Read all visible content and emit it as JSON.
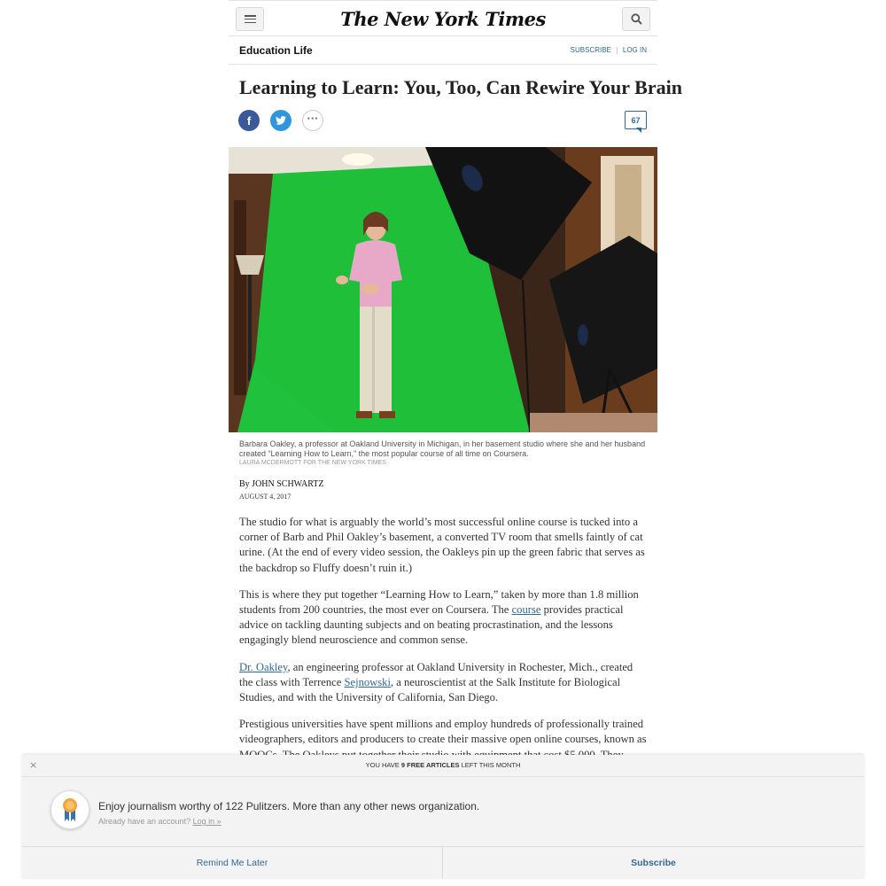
{
  "header": {
    "masthead": "The New York Times",
    "menu_icon": "hamburger-menu-icon",
    "search_icon": "search-icon"
  },
  "section": {
    "name": "Education Life",
    "subscribe": "SUBSCRIBE",
    "login": "LOG IN"
  },
  "article": {
    "headline": "Learning to Learn: You, Too, Can Rewire Your Brain",
    "share": {
      "facebook": "f",
      "more": "···"
    },
    "comment_count": "67",
    "caption": "Barbara Oakley, a professor at Oakland University in Michigan, in her basement studio where she and her husband created “Learning How to Learn,” the most popular course of all time on Coursera.",
    "credit": "LAURA MCDERMOTT FOR THE NEW YORK TIMES",
    "byline_prefix": "By",
    "author": "JOHN SCHWARTZ",
    "date": "AUGUST 4, 2017",
    "p1": "The studio for what is arguably the world’s most successful online course is tucked into a corner of Barb and Phil Oakley’s basement, a converted TV room that smells faintly of cat urine. (At the end of every video session, the Oakleys pin up the green fabric that serves as the backdrop so Fluffy doesn’t ruin it.)",
    "p2_a": "This is where they put together “Learning How to Learn,” taken by more than 1.8 million students from 200 countries, the most ever on Coursera. The ",
    "p2_link": "course",
    "p2_b": " provides practical advice on tackling daunting subjects and on beating procrastination, and the lessons engagingly blend neuroscience and common sense.",
    "p3_link1": "Dr. Oakley",
    "p3_a": ", an engineering professor at Oakland University in Rochester, Mich., created the class with Terrence ",
    "p3_link2": "Sejnowski",
    "p3_b": ", a neuroscientist at the Salk Institute for Biological Studies, and with the University of California, San Diego.",
    "p4": "Prestigious universities have spent millions and employ hundreds of professionally trained videographers, editors and producers to create their massive open online courses, known as MOOCs. The Oakleys put together their studio with equipment that cost $5,000. They"
  },
  "paywall": {
    "close": "×",
    "counter_a": "YOU HAVE",
    "counter_b": "9 FREE ARTICLES",
    "counter_c": "LEFT THIS MONTH",
    "pitch": "Enjoy journalism worthy of 122 Pulitzers. More than any other news organization.",
    "login_prompt": "Already have an account?",
    "login_link": "Log in »",
    "remind_label": "Remind Me Later",
    "subscribe_label": "Subscribe"
  },
  "colors": {
    "link": "#326891",
    "facebook": "#3b5998",
    "twitter": "#2f95dc",
    "backdrop_green": "#1fbf3a"
  }
}
